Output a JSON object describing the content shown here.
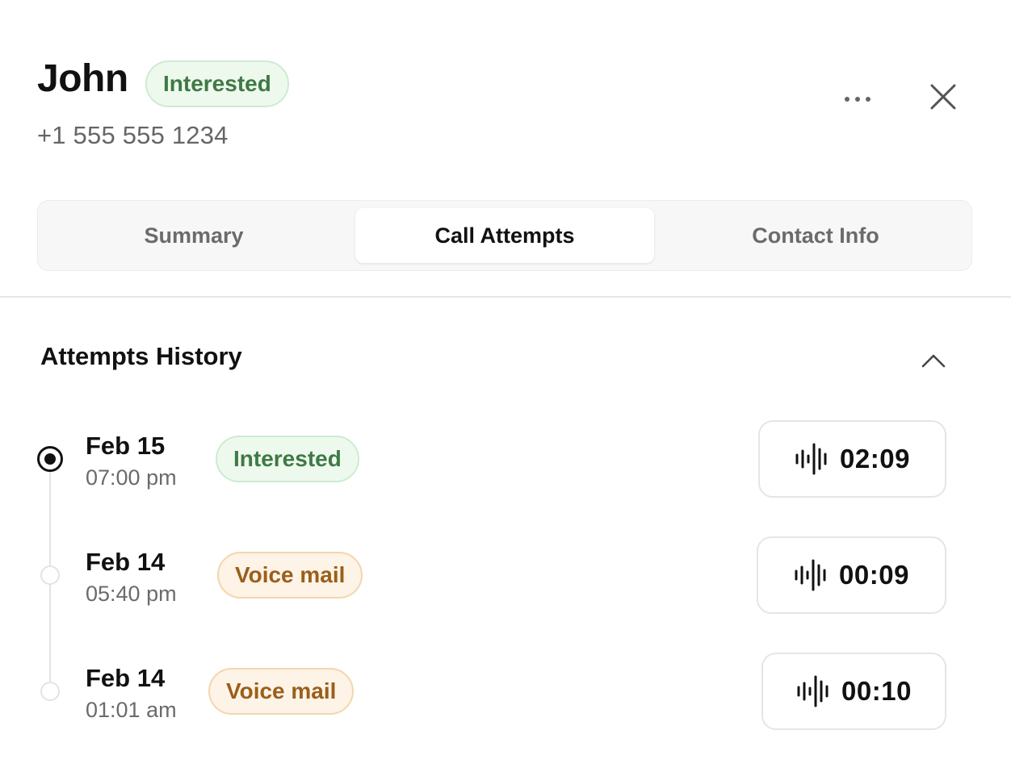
{
  "contact": {
    "name": "John",
    "status": "Interested",
    "phone": "+1 555 555 1234"
  },
  "header": {
    "more_icon": "ellipsis-icon",
    "close_icon": "close-icon"
  },
  "tabs": [
    {
      "label": "Summary",
      "active": false
    },
    {
      "label": "Call Attempts",
      "active": true
    },
    {
      "label": "Contact Info",
      "active": false
    }
  ],
  "section": {
    "title": "Attempts History",
    "collapse_icon": "chevron-up-icon"
  },
  "attempts": [
    {
      "date": "Feb 15",
      "time": "07:00 pm",
      "status": "Interested",
      "status_color": "green",
      "duration": "02:09",
      "current": true
    },
    {
      "date": "Feb 14",
      "time": "05:40 pm",
      "status": "Voice mail",
      "status_color": "orange",
      "duration": "00:09",
      "current": false
    },
    {
      "date": "Feb 14",
      "time": "01:01 am",
      "status": "Voice mail",
      "status_color": "orange",
      "duration": "00:10",
      "current": false
    }
  ],
  "colors": {
    "interested_text": "#3f7a44",
    "interested_bg": "#eef9ee",
    "voicemail_text": "#9a5f1b",
    "voicemail_bg": "#fdf3e6"
  }
}
